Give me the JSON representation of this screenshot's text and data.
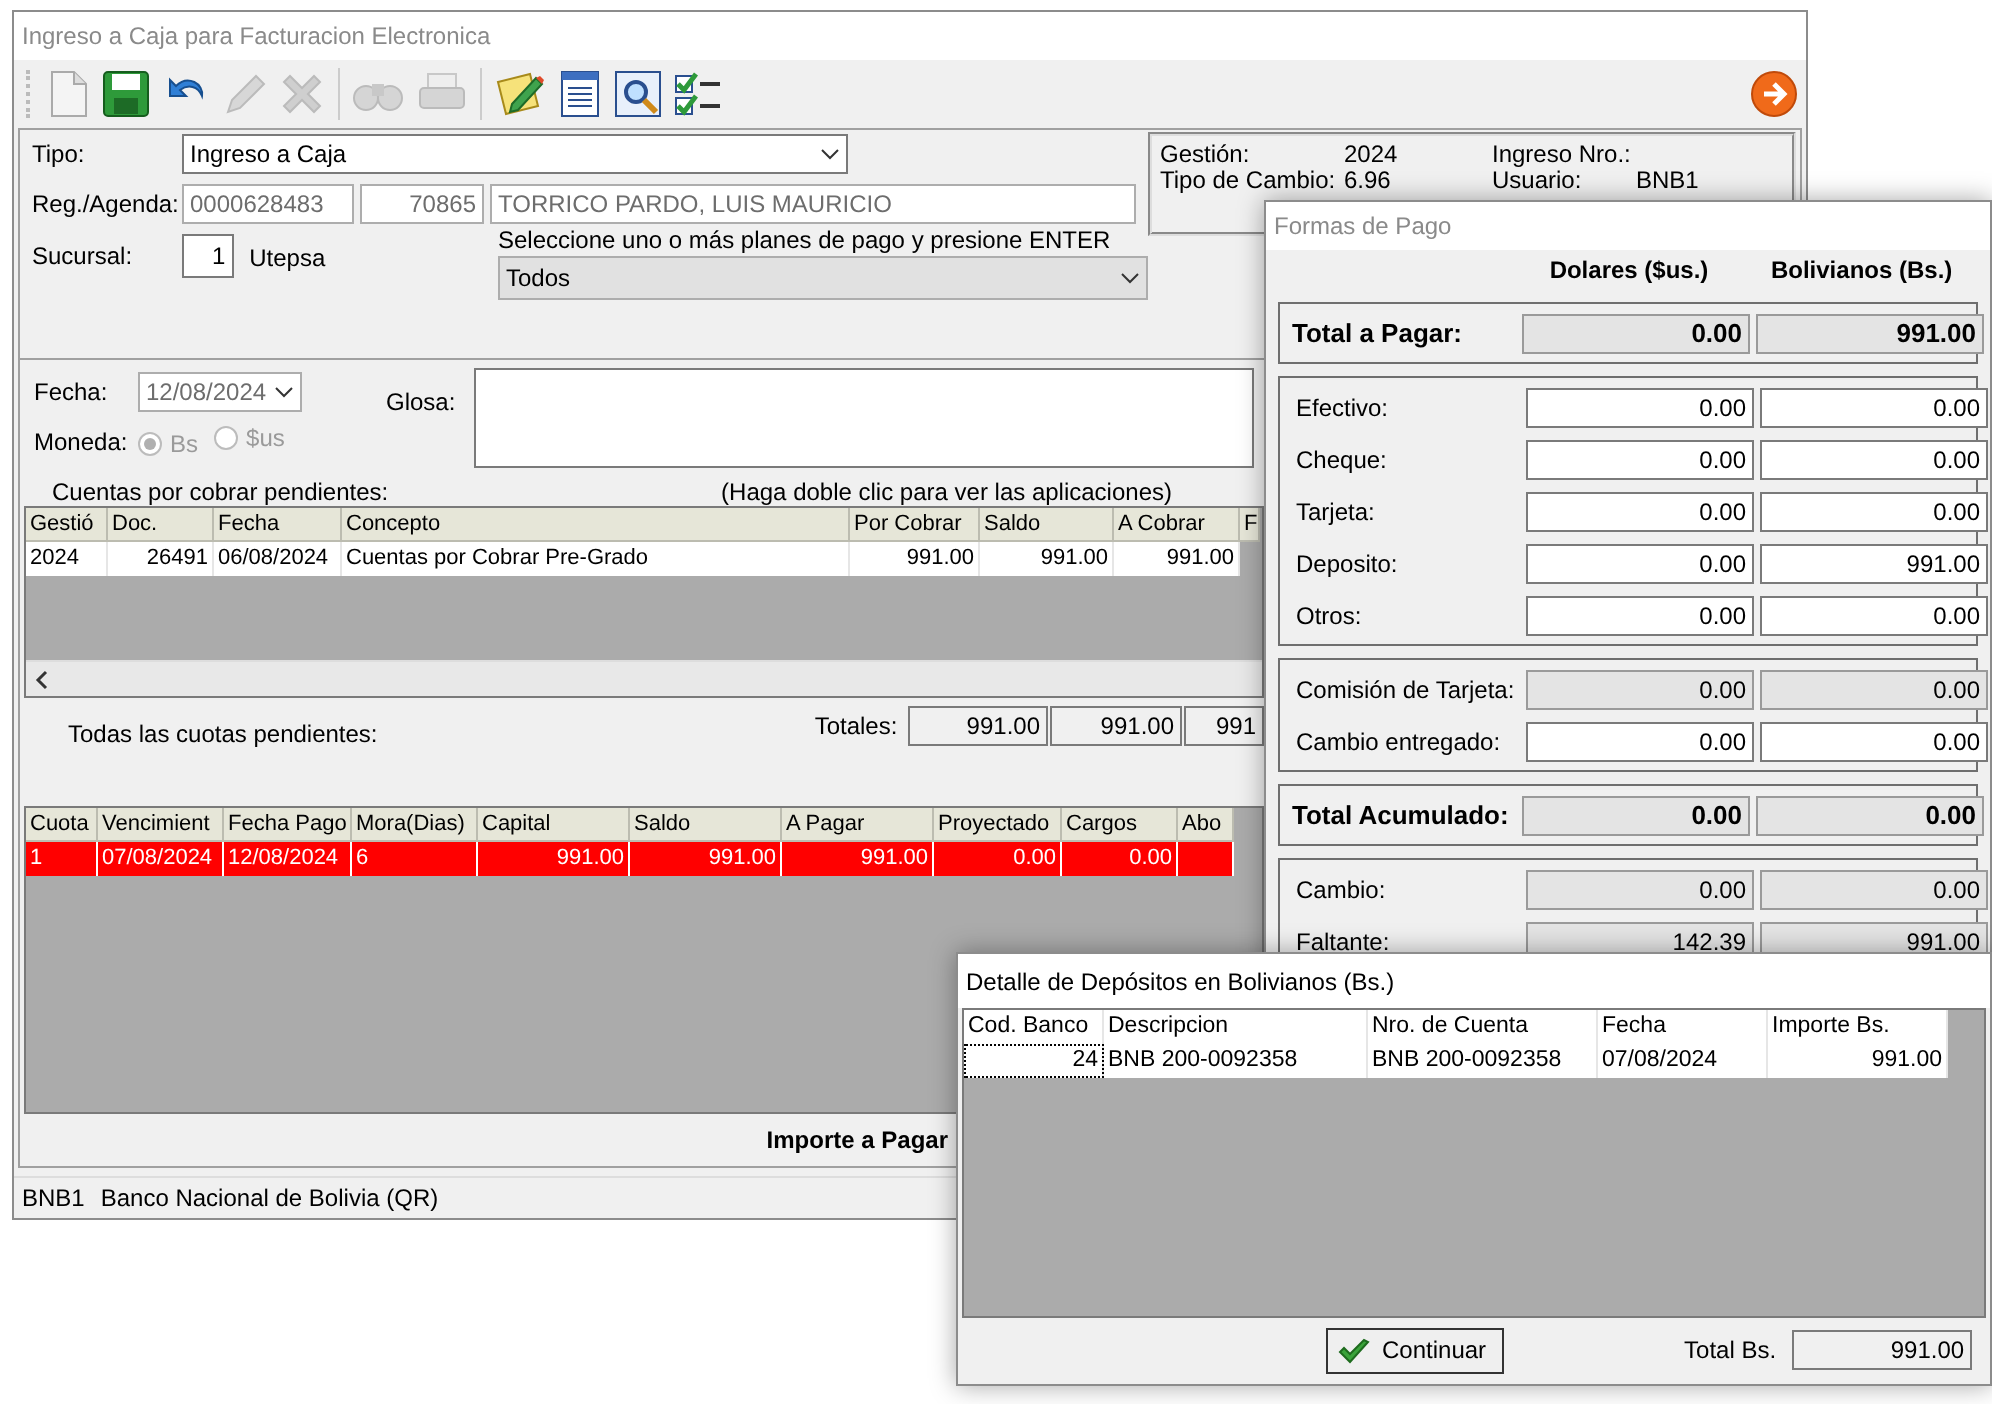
{
  "window": {
    "title": "Ingreso a Caja para Facturacion Electronica"
  },
  "toolbar": [
    {
      "kind": "new",
      "disabled": false
    },
    {
      "kind": "save",
      "disabled": false
    },
    {
      "kind": "undo",
      "disabled": false
    },
    {
      "kind": "edit",
      "disabled": true
    },
    {
      "kind": "delete",
      "disabled": true
    },
    {
      "kind": "separator"
    },
    {
      "kind": "find",
      "disabled": true
    },
    {
      "kind": "print",
      "disabled": true
    },
    {
      "kind": "separator"
    },
    {
      "kind": "notes",
      "disabled": false
    },
    {
      "kind": "list",
      "disabled": false
    },
    {
      "kind": "preview",
      "disabled": false
    },
    {
      "kind": "checklist",
      "disabled": false
    }
  ],
  "header": {
    "tipo": {
      "label": "Tipo:",
      "value": "Ingreso a Caja"
    },
    "registro": {
      "label": "Reg./Agenda:",
      "values": [
        "0000628483",
        "70865",
        "TORRICO PARDO, LUIS MAURICIO"
      ]
    },
    "sucursal": {
      "label": "Sucursal:",
      "value": "1",
      "name": "Utepsa"
    },
    "planes": {
      "hint": "Seleccione uno o más planes de pago y presione ENTER",
      "value": "Todos"
    }
  },
  "info": [
    {
      "label": "Gestión:",
      "value": "2024"
    },
    {
      "label": "Ingreso Nro.:"
    },
    {
      "label": "Tipo de Cambio:",
      "value": "6.96"
    },
    {
      "label": "Usuario:",
      "value": "BNB1"
    }
  ],
  "fecha": {
    "label": "Fecha:",
    "value": "12/08/2024",
    "disabled": true
  },
  "glosa": {
    "label": "Glosa:"
  },
  "moneda": {
    "label": "Moneda:",
    "disabled": true,
    "options": [
      {
        "label": "Bs",
        "selected": true
      },
      {
        "label": "$us",
        "selected": false
      }
    ]
  },
  "cuentas": {
    "title": "Cuentas por cobrar pendientes:",
    "hint": "(Haga doble clic para ver las aplicaciones)",
    "columns": [
      "Gestió",
      "Doc.",
      "Fecha",
      "Concepto",
      "Por Cobrar",
      "Saldo",
      "A Cobrar",
      "F"
    ],
    "rows": [
      [
        "2024",
        "26491",
        "06/08/2024",
        "Cuentas por Cobrar Pre-Grado",
        "991.00",
        "991.00",
        "991.00"
      ]
    ],
    "totals_label": "Totales:",
    "totals": [
      "991.00",
      "991.00",
      "991"
    ]
  },
  "cuotas": {
    "title": "Todas las cuotas pendientes:",
    "columns": [
      "Cuota",
      "Vencimient",
      "Fecha Pago",
      "Mora(Dias)",
      "Capital",
      "Saldo",
      "A Pagar",
      "Proyectado",
      "Cargos",
      "Abo"
    ],
    "rows": [
      {
        "overdue": true,
        "cells": [
          "1",
          "07/08/2024",
          "12/08/2024",
          "6",
          "991.00",
          "991.00",
          "991.00",
          "0.00",
          "0.00"
        ]
      }
    ],
    "importe_label": "Importe a Pagar"
  },
  "status_bar": [
    "BNB1",
    "Banco Nacional de Bolivia (QR)"
  ],
  "formas_pago": {
    "title": "Formas de Pago",
    "columns": [
      "Dolares ($us.)",
      "Bolivianos (Bs.)"
    ],
    "sections": [
      {
        "kind": "total",
        "rows": [
          {
            "label": "Total a Pagar:",
            "readonly": true,
            "values": [
              "0.00",
              "991.00"
            ]
          }
        ]
      },
      {
        "kind": "entries",
        "rows": [
          {
            "label": "Efectivo:",
            "readonly": false,
            "values": [
              "0.00",
              "0.00"
            ]
          },
          {
            "label": "Cheque:",
            "readonly": false,
            "values": [
              "0.00",
              "0.00"
            ]
          },
          {
            "label": "Tarjeta:",
            "readonly": false,
            "values": [
              "0.00",
              "0.00"
            ]
          },
          {
            "label": "Deposito:",
            "readonly": false,
            "values": [
              "0.00",
              "991.00"
            ]
          },
          {
            "label": "Otros:",
            "readonly": false,
            "values": [
              "0.00",
              "0.00"
            ]
          }
        ]
      },
      {
        "kind": "entries",
        "rows": [
          {
            "label": "Comisión de Tarjeta:",
            "readonly": true,
            "values": [
              "0.00",
              "0.00"
            ]
          },
          {
            "label": "Cambio entregado:",
            "readonly": false,
            "values": [
              "0.00",
              "0.00"
            ]
          }
        ]
      },
      {
        "kind": "total",
        "rows": [
          {
            "label": "Total Acumulado:",
            "readonly": true,
            "values": [
              "0.00",
              "0.00"
            ]
          }
        ]
      },
      {
        "kind": "entries",
        "rows": [
          {
            "label": "Cambio:",
            "readonly": true,
            "values": [
              "0.00",
              "0.00"
            ]
          },
          {
            "label": "Faltante:",
            "readonly": true,
            "values": [
              "142.39",
              "991.00"
            ]
          }
        ]
      }
    ]
  },
  "depositos": {
    "title": "Detalle de Depósitos en Bolivianos (Bs.)",
    "columns": [
      "Cod. Banco",
      "Descripcion",
      "Nro. de Cuenta",
      "Fecha",
      "Importe Bs."
    ],
    "rows": [
      [
        "24",
        "BNB 200-0092358",
        "BNB 200-0092358",
        "07/08/2024",
        "991.00"
      ]
    ],
    "button": "Continuar",
    "total_label": "Total Bs.",
    "total": "991.00"
  }
}
